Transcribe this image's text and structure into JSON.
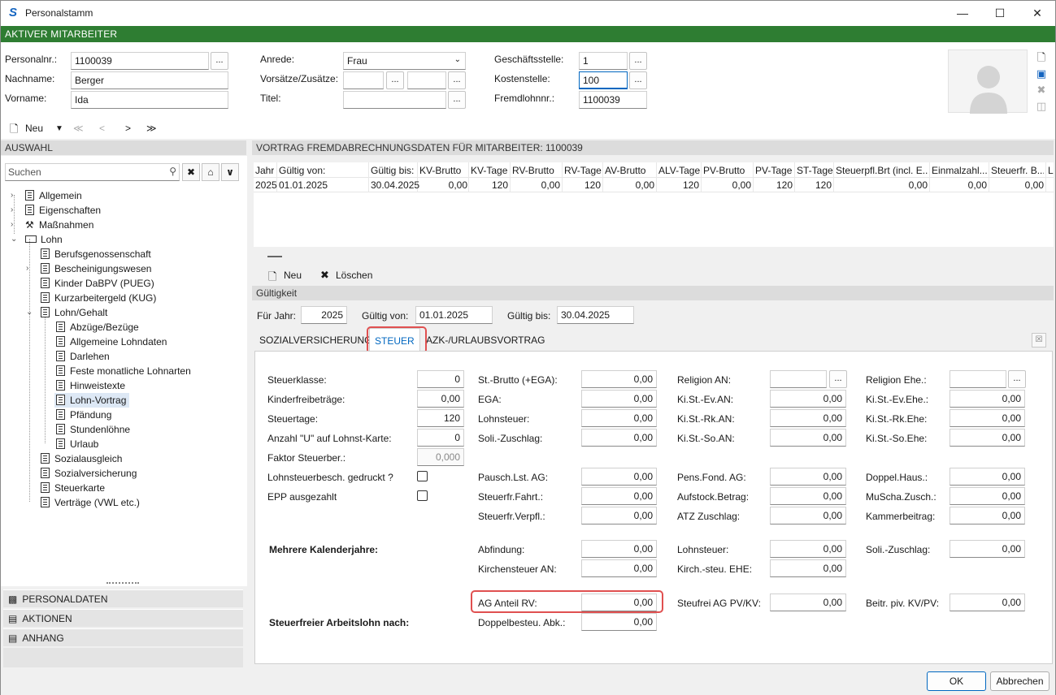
{
  "window": {
    "title": "Personalstamm",
    "app_icon": "S"
  },
  "banner": {
    "label": "AKTIVER MITARBEITER"
  },
  "header": {
    "personalnr_label": "Personalnr.:",
    "personalnr": "1100039",
    "nachname_label": "Nachname:",
    "nachname": "Berger",
    "vorname_label": "Vorname:",
    "vorname": "Ida",
    "anrede_label": "Anrede:",
    "anrede": "Frau",
    "vorsaetze_label": "Vorsätze/Zusätze:",
    "titel_label": "Titel:",
    "geschaeftsstelle_label": "Geschäftsstelle:",
    "geschaeftsstelle": "1",
    "kostenstelle_label": "Kostenstelle:",
    "kostenstelle": "100",
    "fremdlohnnr_label": "Fremdlohnnr.:",
    "fremdlohnnr": "1100039",
    "dots": "..."
  },
  "navbar": {
    "neu": "Neu",
    "first": "≪",
    "prev": "<",
    "next": ">",
    "last": "≫"
  },
  "left": {
    "section_title": "AUSWAHL",
    "search_placeholder": "Suchen",
    "tree": [
      {
        "label": "Allgemein"
      },
      {
        "label": "Eigenschaften"
      },
      {
        "label": "Maßnahmen"
      },
      {
        "label": "Lohn"
      },
      {
        "label": "Berufsgenossenschaft"
      },
      {
        "label": "Bescheinigungswesen"
      },
      {
        "label": "Kinder DaBPV (PUEG)"
      },
      {
        "label": "Kurzarbeitergeld (KUG)"
      },
      {
        "label": "Lohn/Gehalt"
      },
      {
        "label": "Abzüge/Bezüge"
      },
      {
        "label": "Allgemeine Lohndaten"
      },
      {
        "label": "Darlehen"
      },
      {
        "label": "Feste monatliche Lohnarten"
      },
      {
        "label": "Hinweistexte"
      },
      {
        "label": "Lohn-Vortrag"
      },
      {
        "label": "Pfändung"
      },
      {
        "label": "Stundenlöhne"
      },
      {
        "label": "Urlaub"
      },
      {
        "label": "Sozialausgleich"
      },
      {
        "label": "Sozialversicherung"
      },
      {
        "label": "Steuerkarte"
      },
      {
        "label": "Verträge (VWL etc.)"
      }
    ],
    "accordion": [
      "PERSONALDATEN",
      "AKTIONEN",
      "ANHANG"
    ]
  },
  "right": {
    "section_title": "VORTRAG FREMDABRECHNUNGSDATEN FÜR MITARBEITER: 1100039",
    "grid": {
      "headers": [
        "Jahr",
        "Gültig von:",
        "Gültig bis:",
        "KV-Brutto",
        "KV-Tage",
        "RV-Brutto",
        "RV-Tage",
        "AV-Brutto",
        "ALV-Tage",
        "PV-Brutto",
        "PV-Tage",
        "ST-Tage",
        "Steuerpfl.Brt (incl. E...",
        "Einmalzahl...",
        "Steuerfr. B...",
        "L"
      ],
      "row": [
        "2025",
        "01.01.2025",
        "30.04.2025",
        "0,00",
        "120",
        "0,00",
        "120",
        "0,00",
        "120",
        "0,00",
        "120",
        "120",
        "0,00",
        "0,00",
        "0,00",
        ""
      ]
    },
    "toolbar": {
      "neu": "Neu",
      "loeschen": "Löschen"
    },
    "gueltigkeit_title": "Gültigkeit",
    "fuer_jahr_label": "Für Jahr:",
    "fuer_jahr": "2025",
    "gueltig_von_label": "Gültig von:",
    "gueltig_von": "01.01.2025",
    "gueltig_bis_label": "Gültig bis:",
    "gueltig_bis": "30.04.2025",
    "tabs": [
      "SOZIALVERSICHERUNG",
      "STEUER",
      "AZK-/URLAUBSVORTRAG"
    ],
    "steuer": {
      "col1": [
        {
          "label": "Steuerklasse:",
          "value": "0"
        },
        {
          "label": "Kinderfreibeträge:",
          "value": "0,00"
        },
        {
          "label": "Steuertage:",
          "value": "120"
        },
        {
          "label": "Anzahl \"U\" auf Lohnst-Karte:",
          "value": "0"
        },
        {
          "label": "Faktor Steuerber.:",
          "value": "0,000"
        }
      ],
      "chk1_label": "Lohnsteuerbesch. gedruckt ?",
      "chk2_label": "EPP ausgezahlt",
      "col2": [
        {
          "label": "St.-Brutto (+EGA):",
          "value": "0,00"
        },
        {
          "label": "EGA:",
          "value": "0,00"
        },
        {
          "label": "Lohnsteuer:",
          "value": "0,00"
        },
        {
          "label": "Soli.-Zuschlag:",
          "value": "0,00"
        },
        {
          "label": "Pausch.Lst. AG:",
          "value": "0,00"
        },
        {
          "label": "Steuerfr.Fahrt.:",
          "value": "0,00"
        },
        {
          "label": "Steuerfr.Verpfl.:",
          "value": "0,00"
        }
      ],
      "col3": [
        {
          "label": "Religion AN:",
          "value": ""
        },
        {
          "label": "Ki.St.-Ev.AN:",
          "value": "0,00"
        },
        {
          "label": "Ki.St.-Rk.AN:",
          "value": "0,00"
        },
        {
          "label": "Ki.St.-So.AN:",
          "value": "0,00"
        },
        {
          "label": "Pens.Fond. AG:",
          "value": "0,00"
        },
        {
          "label": "Aufstock.Betrag:",
          "value": "0,00"
        },
        {
          "label": "ATZ Zuschlag:",
          "value": "0,00"
        }
      ],
      "col4": [
        {
          "label": "Religion Ehe.:",
          "value": ""
        },
        {
          "label": "Ki.St.-Ev.Ehe.:",
          "value": "0,00"
        },
        {
          "label": "Ki.St.-Rk.Ehe:",
          "value": "0,00"
        },
        {
          "label": "Ki.St.-So.Ehe:",
          "value": "0,00"
        },
        {
          "label": "Doppel.Haus.:",
          "value": "0,00"
        },
        {
          "label": "MuScha.Zusch.:",
          "value": "0,00"
        },
        {
          "label": "Kammerbeitrag:",
          "value": "0,00"
        }
      ],
      "mehrere_title": "Mehrere Kalenderjahre:",
      "mk": [
        {
          "label": "Abfindung:",
          "value": "0,00"
        },
        {
          "label": "Kirchensteuer AN:",
          "value": "0,00"
        },
        {
          "label": "Lohnsteuer:",
          "value": "0,00"
        },
        {
          "label": "Kirch.-steu. EHE:",
          "value": "0,00"
        },
        {
          "label": "Soli.-Zuschlag:",
          "value": "0,00"
        }
      ],
      "stfrei_title": "Steuerfreier Arbeitslohn nach:",
      "sf": [
        {
          "label": "AG Anteil RV:",
          "value": "0,00"
        },
        {
          "label": "Doppelbesteu. Abk.:",
          "value": "0,00"
        },
        {
          "label": "Steufrei AG PV/KV:",
          "value": "0,00"
        },
        {
          "label": "Beitr. piv. KV/PV:",
          "value": "0,00"
        }
      ]
    }
  },
  "footer": {
    "ok": "OK",
    "abbrechen": "Abbrechen"
  }
}
